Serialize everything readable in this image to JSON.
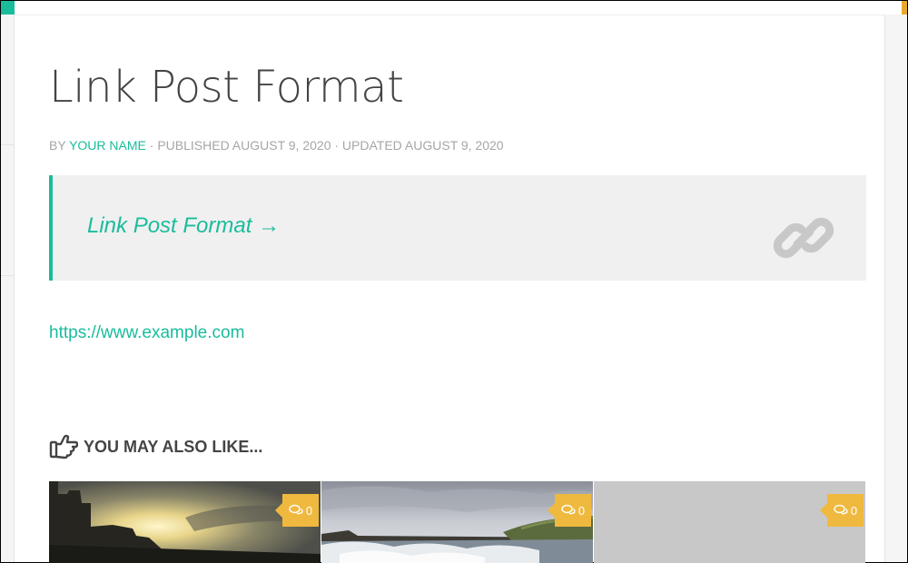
{
  "post": {
    "title": "Link Post Format",
    "meta": {
      "by": "BY",
      "author": "YOUR NAME",
      "published": "· PUBLISHED AUGUST 9, 2020",
      "updated": "· UPDATED AUGUST 9, 2020"
    },
    "link_box": {
      "text": "Link Post Format →",
      "icon": "chain-link-icon"
    },
    "url": "https://www.example.com"
  },
  "related": {
    "heading": "YOU MAY ALSO LIKE...",
    "icon": "hand-pointing-right-icon",
    "items": [
      {
        "comments": "0",
        "image": "sunset-over-building"
      },
      {
        "comments": "0",
        "image": "waterfall-landscape"
      },
      {
        "comments": "0",
        "image": "placeholder"
      }
    ]
  },
  "colors": {
    "accent": "#1abc9c",
    "badge": "#efb93f",
    "text": "#444444",
    "muted": "#a6a6a6",
    "box_bg": "#f0f0f0"
  }
}
